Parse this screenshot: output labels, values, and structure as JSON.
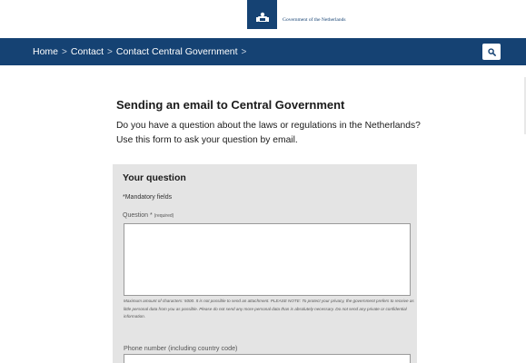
{
  "header": {
    "logo_text": "Government of the Netherlands"
  },
  "nav": {
    "breadcrumb": [
      "Home",
      "Contact",
      "Contact Central Government"
    ],
    "separator": ">",
    "search_icon": "search-icon"
  },
  "main": {
    "title": "Sending an email to Central Government",
    "intro": "Do you have a question about the laws or regulations in the Netherlands? Use this form to ask your question by email."
  },
  "form": {
    "section_title": "Your question",
    "mandatory_note": "*Mandatory fields",
    "question_label": "Question *",
    "question_required": "(required)",
    "question_value": "",
    "help_text": "Maximum amount of characters: 5000. It is not possible to send an attachment. PLEASE NOTE: To protect your privacy, the government prefers to receive as little personal data from you as possible. Please do not send any more personal data than is absolutely necessary. Do not send any private or confidential information.",
    "phone_label": "Phone number (including country code)",
    "phone_value": ""
  },
  "colors": {
    "brand": "#154273",
    "panel": "#e4e4e4"
  }
}
